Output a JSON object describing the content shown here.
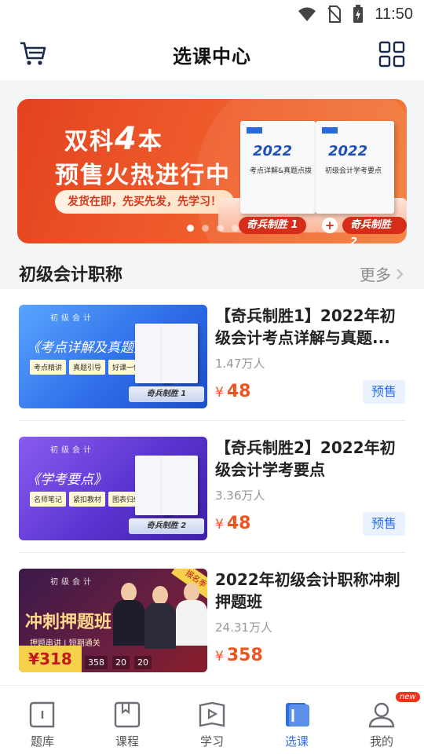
{
  "status_bar": {
    "time": "11:50",
    "icons": [
      "wifi-icon",
      "no-sim-icon",
      "battery-charging-icon"
    ]
  },
  "header": {
    "title": "选课中心",
    "left_icon": "cart-icon",
    "right_icon": "grid-icon"
  },
  "banner": {
    "headline_prefix": "双科",
    "headline_number": "4",
    "headline_suffix": "本",
    "headline2": "预售火热进行中",
    "pill": "发货在即，先买先发，先学习！",
    "book1": {
      "year": "2022",
      "title": "考点详解&真题点拨"
    },
    "book2": {
      "year": "2022",
      "title": "初级会计学考要点"
    },
    "label1": "奇兵制胜 1",
    "label2": "奇兵制胜 2",
    "plus": "+",
    "dots": 4,
    "active_dot": 0
  },
  "section": {
    "title": "初级会计职称",
    "more": "更多"
  },
  "courses": [
    {
      "title": "【奇兵制胜1】2022年初级会计考点详解与真题...",
      "count": "1.47万人",
      "currency": "¥",
      "price": "48",
      "badge": "预售",
      "thumb": {
        "category": "初级会计",
        "name": "《考点详解及真题点拨》",
        "tags": [
          "考点精讲",
          "真题引导",
          "好课一体"
        ],
        "platform_label": "奇兵制胜 1"
      }
    },
    {
      "title": "【奇兵制胜2】2022年初级会计学考要点",
      "count": "3.36万人",
      "currency": "¥",
      "price": "48",
      "badge": "预售",
      "thumb": {
        "category": "初级会计",
        "name": "《学考要点》",
        "tags": [
          "名师笔记",
          "紧扣教材",
          "图表归纳"
        ],
        "platform_label": "奇兵制胜 2"
      }
    },
    {
      "title": "2022年初级会计职称冲刺押题班",
      "count": "24.31万人",
      "currency": "¥",
      "price": "358",
      "badge": "",
      "thumb": {
        "category": "初级会计",
        "name": "冲刺押题班",
        "sub": "押题串讲 | 短期通关",
        "corner": "报名季",
        "price_tag": "¥318",
        "strip": [
          "358",
          "20",
          "20"
        ]
      }
    }
  ],
  "bottom_nav": [
    {
      "label": "题库",
      "icon": "question-bank-icon",
      "active": false
    },
    {
      "label": "课程",
      "icon": "course-book-icon",
      "active": false
    },
    {
      "label": "学习",
      "icon": "play-video-icon",
      "active": false
    },
    {
      "label": "选课",
      "icon": "choose-course-icon",
      "active": true
    },
    {
      "label": "我的",
      "icon": "profile-icon",
      "active": false,
      "badge": "new"
    }
  ],
  "colors": {
    "accent": "#2f6fdc",
    "price": "#f0541e",
    "banner": "#e3431f"
  }
}
